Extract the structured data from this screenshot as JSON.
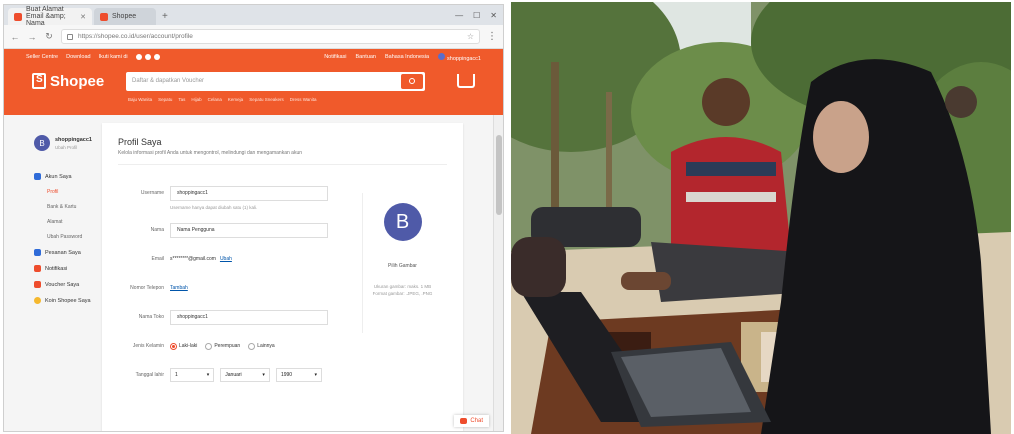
{
  "browser": {
    "tabs": [
      {
        "label": "Buat Alamat Email &amp; Nama",
        "active": true
      },
      {
        "label": "Shopee",
        "active": false
      }
    ],
    "url": "https://shopee.co.id/user/account/profile"
  },
  "shopee": {
    "brand": "Shopee",
    "topnav_left": [
      "Seller Centre",
      "Download",
      "Ikuti kami di"
    ],
    "topnav_right": [
      "Notifikasi",
      "Bantuan",
      "Bahasa Indonesia",
      "shoppingacc1"
    ],
    "search_placeholder": "Daftar & dapatkan Voucher",
    "suggestions": [
      "Baju Wanita",
      "Sepatu",
      "Tas",
      "Hijab",
      "Celana",
      "Kemeja",
      "Sepatu Sneakers",
      "Dress Wanita"
    ],
    "sidebar": {
      "user": "shoppingacc1",
      "edit": "Ubah Profil",
      "items": [
        {
          "label": "Akun Saya",
          "color": "#2f6bd8"
        },
        {
          "label": "Pesanan Saya",
          "color": "#2f6bd8"
        },
        {
          "label": "Notifikasi",
          "color": "#ee4d2d"
        },
        {
          "label": "Voucher Saya",
          "color": "#ee4d2d"
        },
        {
          "label": "Koin Shopee Saya",
          "color": "#f5b82e"
        }
      ],
      "subitems": [
        "Profil",
        "Bank & Kartu",
        "Alamat",
        "Ubah Password"
      ]
    },
    "profile": {
      "title": "Profil Saya",
      "subtitle": "Kelola informasi profil Anda untuk mengontrol, melindungi dan mengamankan akun",
      "username_label": "Username",
      "username_value": "shoppingacc1",
      "username_hint": "Username hanya dapat diubah satu (1) kali.",
      "name_label": "Nama",
      "name_value": "Nama Pengguna",
      "email_label": "Email",
      "email_value": "s********@gmail.com",
      "email_change": "Ubah",
      "phone_label": "Nomor Telepon",
      "phone_value": "Tambah",
      "shop_label": "Nama Toko",
      "shop_value": "shoppingacc1",
      "gender_label": "Jenis Kelamin",
      "gender_options": [
        "Laki-laki",
        "Perempuan",
        "Lainnya"
      ],
      "dob_label": "Tanggal lahir",
      "dob_day": "1",
      "dob_month": "Januari",
      "dob_year": "1990",
      "avatar_letter": "B",
      "pick_image": "Pilih Gambar",
      "avatar_note_1": "Ukuran gambar: maks. 1 MB",
      "avatar_note_2": "Format gambar: .JPEG, .PNG"
    },
    "chat_label": "Chat"
  },
  "colors": {
    "shopee_orange": "#f05a2b",
    "avatar_blue": "#4f5aa8"
  }
}
